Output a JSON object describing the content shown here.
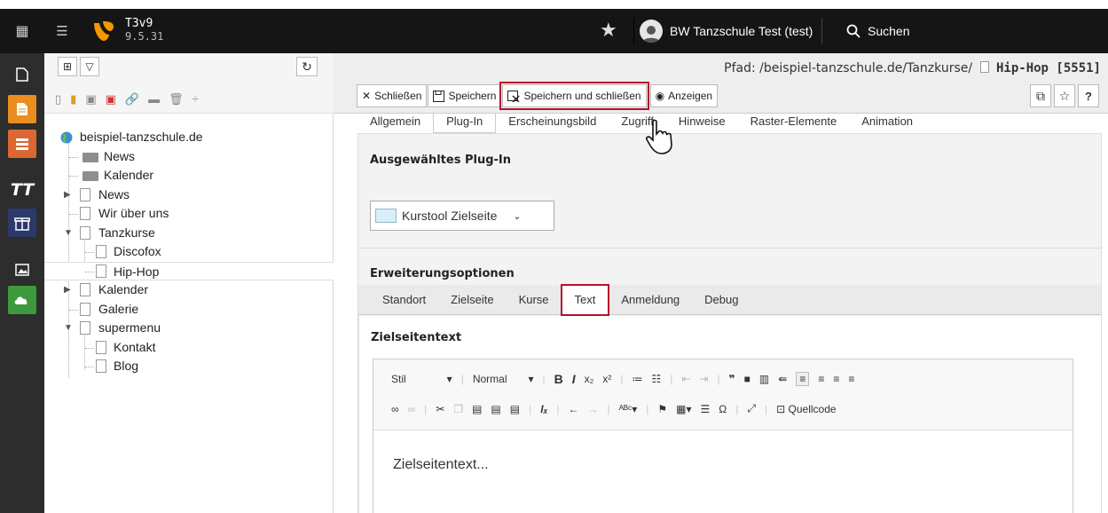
{
  "topbar": {
    "brand_name": "T3v9",
    "brand_version": "9.5.31",
    "user_name": "BW Tanzschule Test (test)",
    "search_label": "Suchen"
  },
  "tree": {
    "root": "beispiel-tanzschule.de",
    "items": [
      {
        "label": "News"
      },
      {
        "label": "Kalender"
      },
      {
        "label": "News"
      },
      {
        "label": "Wir über uns"
      },
      {
        "label": "Tanzkurse"
      },
      {
        "label": "Discofox"
      },
      {
        "label": "Hip-Hop"
      },
      {
        "label": "Kalender"
      },
      {
        "label": "Galerie"
      },
      {
        "label": "supermenu"
      },
      {
        "label": "Kontakt"
      },
      {
        "label": "Blog"
      }
    ]
  },
  "docheader": {
    "path_prefix": "Pfad: /beispiel-tanzschule.de/Tanzkurse/",
    "page_title": "Hip-Hop [5551]",
    "buttons": {
      "close": "Schließen",
      "save": "Speichern",
      "save_close": "Speichern und schließen",
      "view": "Anzeigen"
    },
    "help": "?"
  },
  "tabs": [
    "Allgemein",
    "Plug-In",
    "Erscheinungsbild",
    "Zugriff",
    "Hinweise",
    "Raster-Elemente",
    "Animation"
  ],
  "plugin": {
    "section_title": "Ausgewähltes Plug-In",
    "selected": "Kurstool Zielseite"
  },
  "extension": {
    "section_title": "Erweiterungsoptionen",
    "tabs": [
      "Standort",
      "Zielseite",
      "Kurse",
      "Text",
      "Anmeldung",
      "Debug"
    ]
  },
  "editor": {
    "field_title": "Zielseitentext",
    "style_label": "Stil",
    "format_label": "Normal",
    "source_label": "Quellcode",
    "content": "Zielseitentext..."
  }
}
